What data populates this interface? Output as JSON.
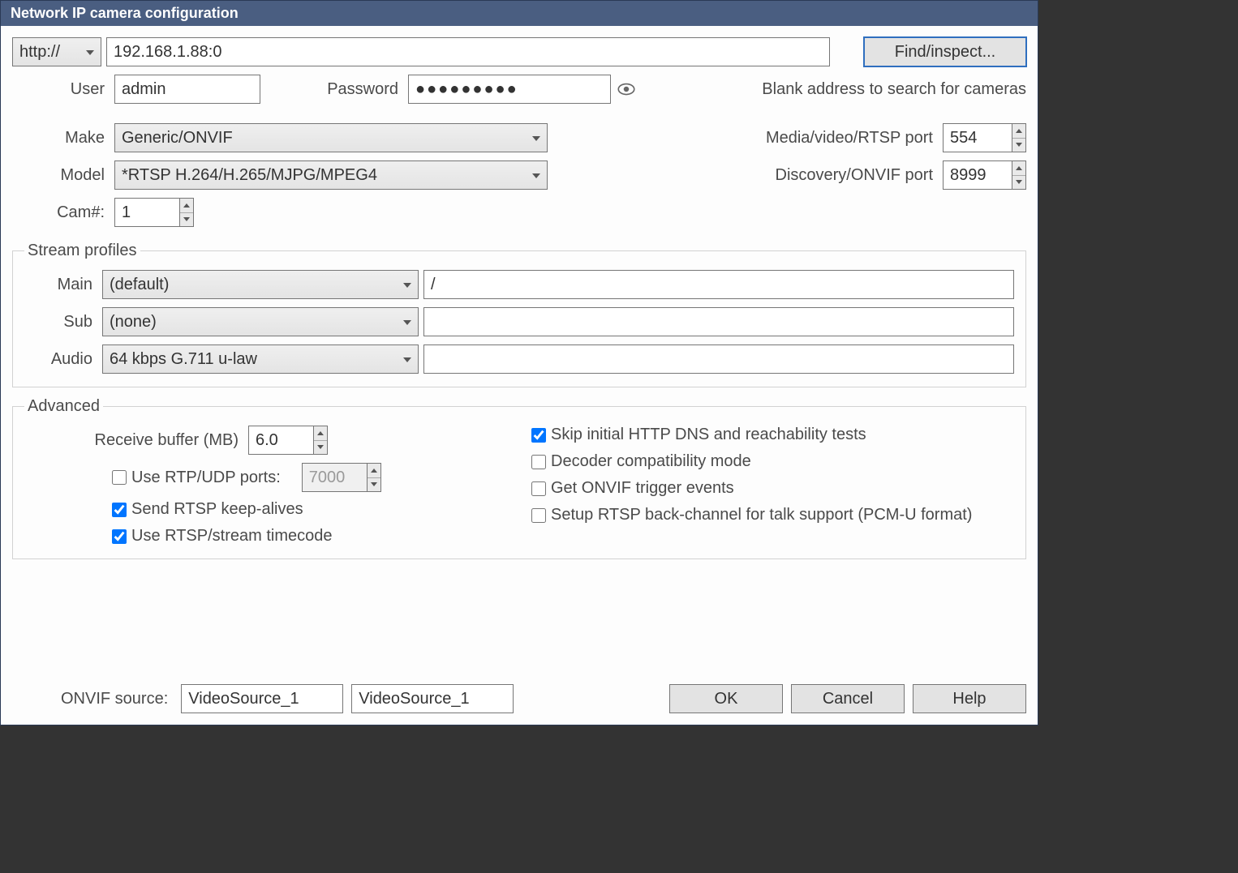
{
  "window_title": "Network IP camera configuration",
  "protocol": "http://",
  "address": "192.168.1.88:0",
  "find_button": "Find/inspect...",
  "user_label": "User",
  "user_value": "admin",
  "password_label": "Password",
  "password_value": "●●●●●●●●●",
  "hint": "Blank address to search for cameras",
  "make_label": "Make",
  "make_value": "Generic/ONVIF",
  "model_label": "Model",
  "model_value": "*RTSP H.264/H.265/MJPG/MPEG4",
  "cam_label": "Cam#:",
  "cam_value": "1",
  "rtsp_port_label": "Media/video/RTSP port",
  "rtsp_port_value": "554",
  "onvif_port_label": "Discovery/ONVIF port",
  "onvif_port_value": "8999",
  "stream_legend": "Stream profiles",
  "main_label": "Main",
  "main_select": "(default)",
  "main_path": "/",
  "sub_label": "Sub",
  "sub_select": "(none)",
  "sub_path": "",
  "audio_label": "Audio",
  "audio_select": "64 kbps G.711 u-law",
  "audio_path": "",
  "advanced_legend": "Advanced",
  "recv_buf_label": "Receive buffer (MB)",
  "recv_buf_value": "6.0",
  "rtp_udp_label": "Use RTP/UDP ports:",
  "rtp_udp_value": "7000",
  "keepalive_label": "Send RTSP keep-alives",
  "timecode_label": "Use RTSP/stream timecode",
  "skip_dns_label": "Skip initial HTTP DNS and reachability tests",
  "decoder_label": "Decoder compatibility mode",
  "trigger_label": "Get ONVIF trigger events",
  "backchan_label": "Setup RTSP back-channel for talk support (PCM-U format)",
  "onvif_src_label": "ONVIF source:",
  "onvif_src1": "VideoSource_1",
  "onvif_src2": "VideoSource_1",
  "ok": "OK",
  "cancel": "Cancel",
  "help": "Help",
  "checks": {
    "rtp_udp": false,
    "keepalive": true,
    "timecode": true,
    "skip_dns": true,
    "decoder": false,
    "trigger": false,
    "backchan": false
  }
}
